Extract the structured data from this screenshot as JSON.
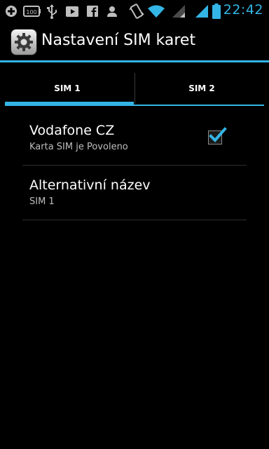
{
  "status_bar": {
    "time": "22:42",
    "battery_badge": "100",
    "icons": [
      "plus-icon",
      "battery-badge-icon",
      "usb-icon",
      "play-store-icon",
      "facebook-icon",
      "person-icon",
      "vibrate-icon",
      "wifi-icon",
      "signal-icon",
      "signal-icon-2",
      "battery-icon"
    ],
    "accent_color": "#33b5e5"
  },
  "action_bar": {
    "title": "Nastavení SIM karet",
    "icon": "settings-gear-icon"
  },
  "tabs": [
    {
      "label": "SIM 1",
      "selected": true
    },
    {
      "label": "SIM 2",
      "selected": false
    }
  ],
  "preferences": [
    {
      "title": "Vodafone CZ",
      "summary": "Karta SIM je Povoleno",
      "checked": true
    },
    {
      "title": "Alternativní název",
      "summary": "SIM 1"
    }
  ],
  "colors": {
    "accent": "#33b5e5",
    "background": "#000000",
    "summary_text": "#bebebe"
  }
}
